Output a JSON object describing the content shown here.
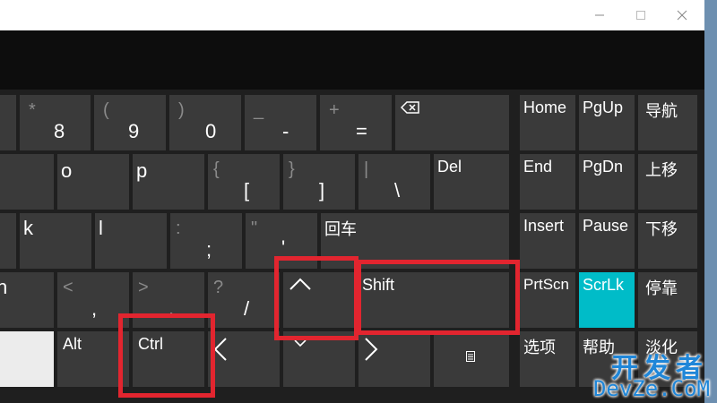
{
  "title_bar": {
    "minimize": "—",
    "maximize": "☐",
    "close": "✕"
  },
  "keys": {
    "row1": {
      "star": "*",
      "eight": "8",
      "lparen": "(",
      "nine": "9",
      "rparen": ")",
      "zero": "0",
      "underscore": "_",
      "minus": "-",
      "plus": "+",
      "equals": "=",
      "backspace_icon": "backspace-icon"
    },
    "row2": {
      "o": "o",
      "p": "p",
      "lbrace": "{",
      "lbracket": "[",
      "rbrace": "}",
      "rbracket": "]",
      "pipe": "|",
      "backslash": "\\",
      "del": "Del"
    },
    "row3": {
      "k": "k",
      "l": "l",
      "colon": ":",
      "semicolon": ";",
      "quote": "\"",
      "apostrophe": "'",
      "enter": "回车"
    },
    "row4": {
      "n_partial": "n",
      "lt": "<",
      "comma": ",",
      "gt": ">",
      "period": ".",
      "question": "?",
      "slash": "/",
      "up_arrow": "^",
      "shift": "Shift"
    },
    "row5": {
      "alt": "Alt",
      "ctrl": "Ctrl",
      "left_arrow": "<",
      "down_arrow": "⌄",
      "right_arrow": ">",
      "menu_icon": "menu-icon"
    },
    "nav": {
      "home": "Home",
      "pgup": "PgUp",
      "navigate": "导航",
      "end": "End",
      "pgdn": "PgDn",
      "move_up": "上移",
      "insert": "Insert",
      "pause": "Pause",
      "move_down": "下移",
      "prtscn": "PrtScn",
      "scrlk": "ScrLk",
      "dock": "停靠",
      "options": "选项",
      "help": "帮助",
      "fade": "淡化"
    }
  },
  "watermark": {
    "line1": "开发者",
    "line2": "DevZe.CoM"
  },
  "colors": {
    "key": "#3a3a3a",
    "active": "#00bcc8",
    "highlight": "#e2252f",
    "background": "#1f1f1f"
  }
}
